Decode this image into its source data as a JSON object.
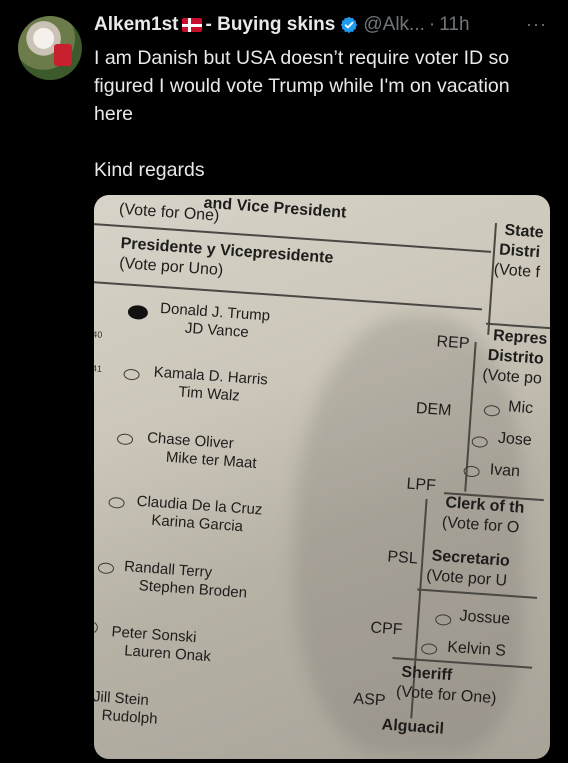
{
  "tweet": {
    "display_name": "Alkem1st",
    "name_suffix": "- Buying skins",
    "handle": "@Alk...",
    "separator": "·",
    "time": "11h",
    "more": "···",
    "text_line1": "I am Danish but USA doesn’t require voter ID so figured I would vote Trump while I'm on vacation here",
    "text_line2": "Kind regards"
  },
  "ballot": {
    "header_top": "and Vice President",
    "vote_for_one": "(Vote for One)",
    "header_es": "Presidente y Vicepresidente",
    "vote_por_uno": "(Vote por Uno)",
    "candidates": [
      {
        "name1": "Donald J. Trump",
        "name2": "JD Vance",
        "party": "REP",
        "marked": true,
        "row": "40"
      },
      {
        "name1": "Kamala D. Harris",
        "name2": "Tim Walz",
        "party": "DEM",
        "marked": false,
        "row": "41"
      },
      {
        "name1": "Chase Oliver",
        "name2": "Mike ter Maat",
        "party": "LPF",
        "marked": false,
        "row": ""
      },
      {
        "name1": "Claudia De la Cruz",
        "name2": "Karina Garcia",
        "party": "PSL",
        "marked": false,
        "row": "5"
      },
      {
        "name1": "Randall Terry",
        "name2": "Stephen Broden",
        "party": "CPF",
        "marked": false,
        "row": ""
      },
      {
        "name1": "Peter Sonski",
        "name2": "Lauren Onak",
        "party": "ASP",
        "marked": false,
        "row": ""
      },
      {
        "name1": "Jill Stein",
        "name2": "Rudolph",
        "party": "",
        "marked": false,
        "row": ""
      }
    ],
    "right": {
      "state": "State",
      "distri": "Distri",
      "vote_t": "(Vote f",
      "repres": "Repres",
      "distrito": "Distrito",
      "vote_po": "(Vote po",
      "opt1": "Mic",
      "opt2": "Jose",
      "opt3": "Ivan",
      "clerk": "Clerk of th",
      "clerk_vote": "(Vote for O",
      "secretario": "Secretario",
      "sec_vote": "(Vote por U",
      "opt4": "Jossue",
      "opt5": "Kelvin S",
      "sheriff": "Sheriff",
      "sheriff_vote": "(Vote for One)",
      "alguacil": "Alguacil"
    }
  }
}
